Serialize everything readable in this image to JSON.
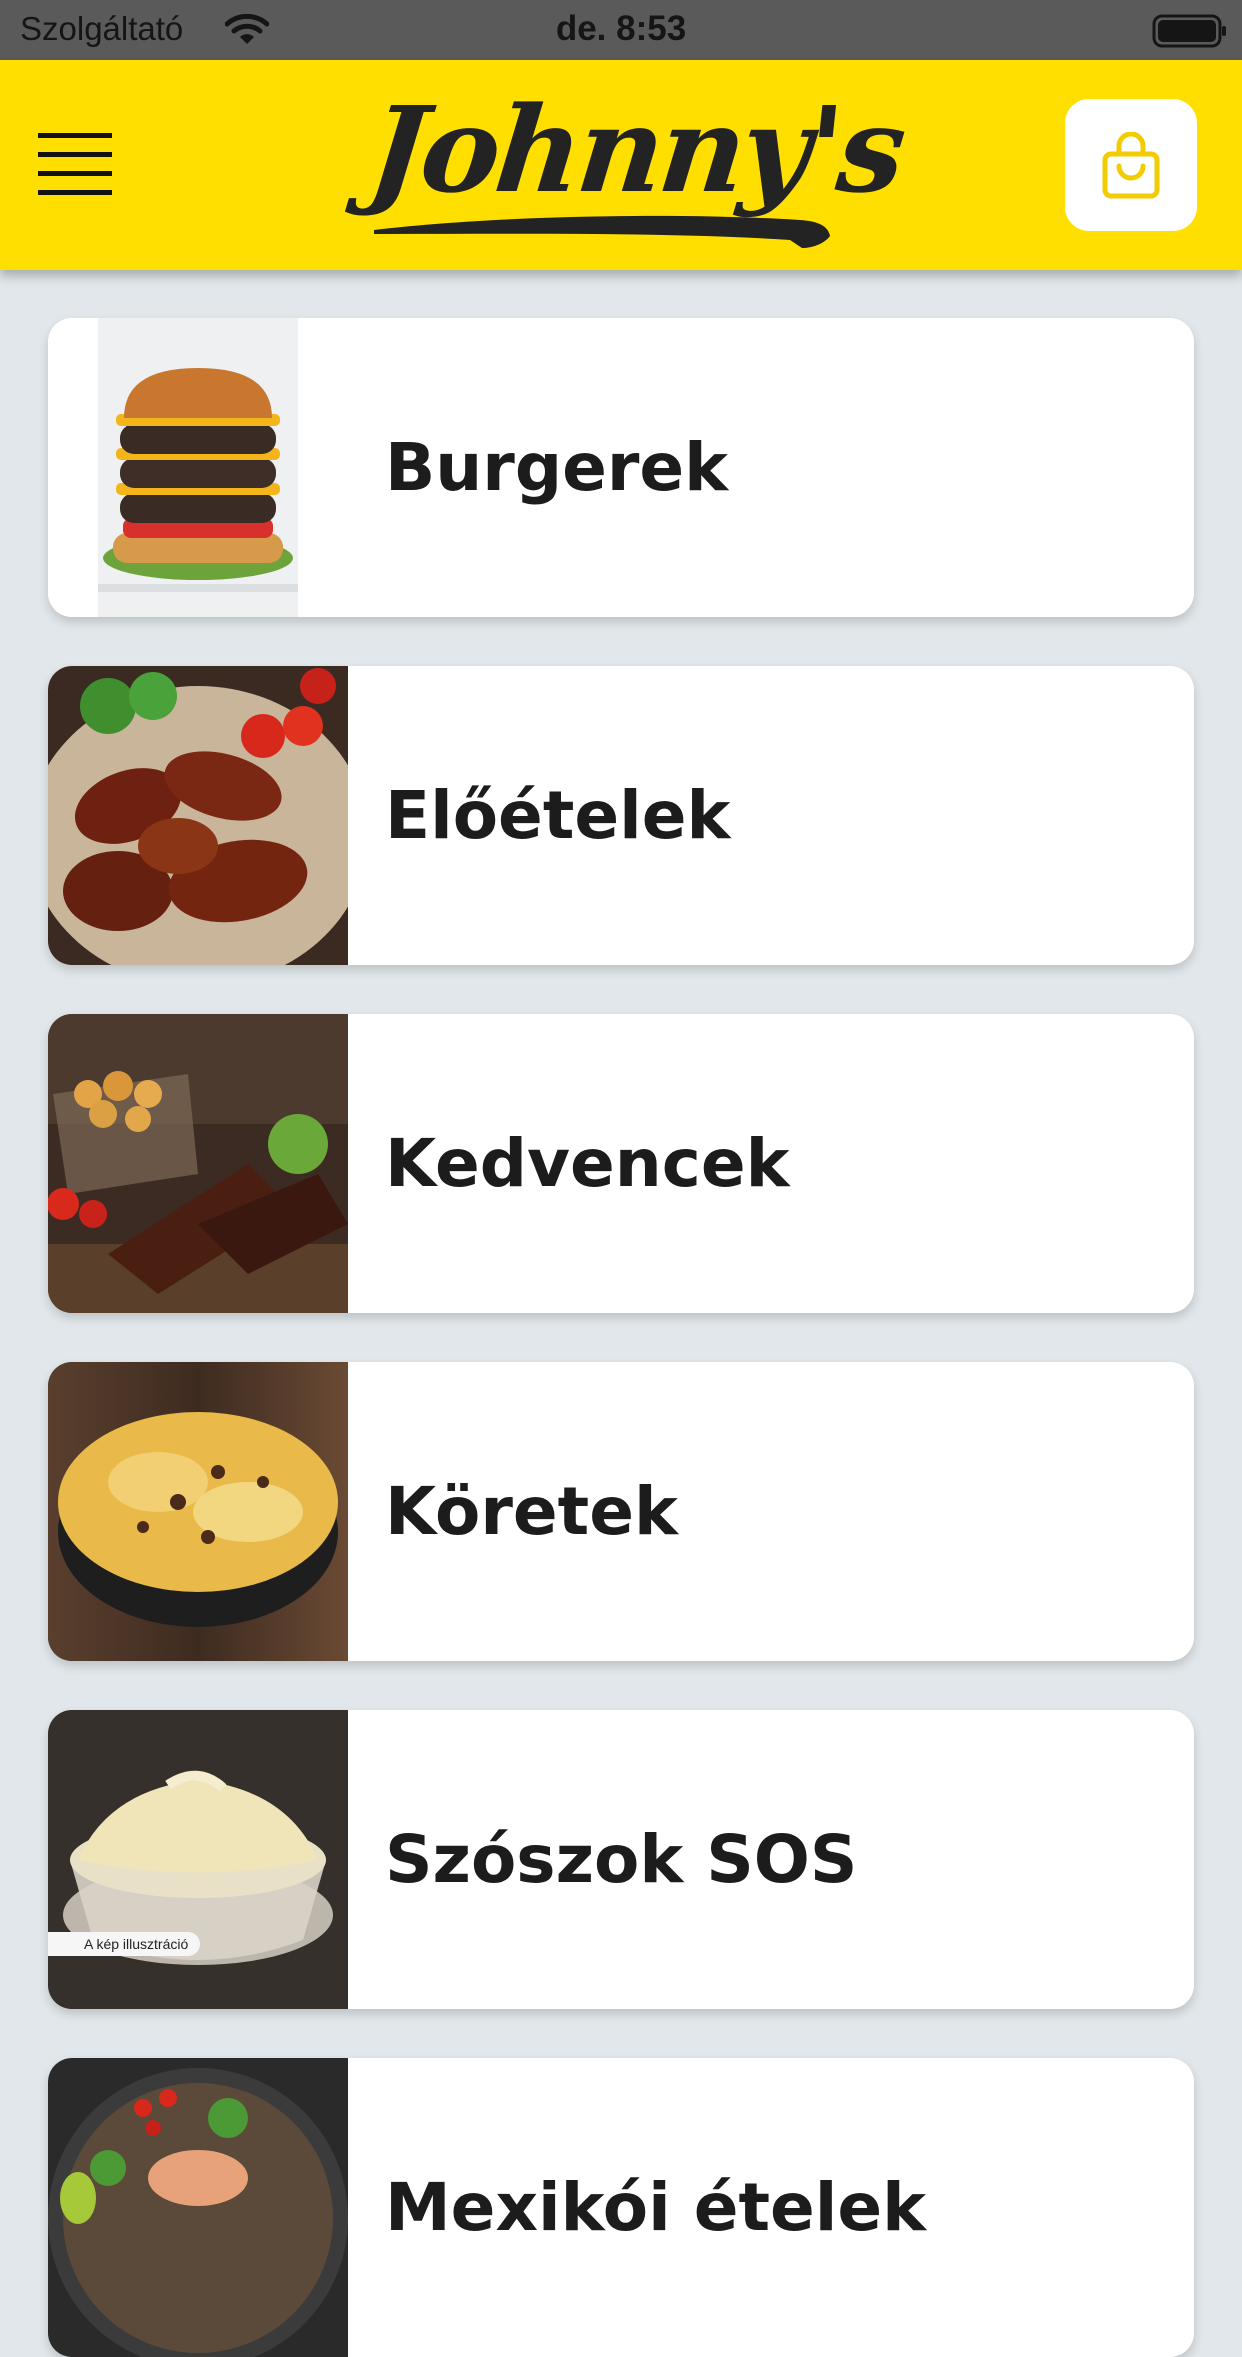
{
  "status_bar": {
    "carrier": "Szolgáltató",
    "time": "de. 8:53"
  },
  "header": {
    "logo_text": "Johnny's",
    "brand_color": "#ffdf00",
    "menu_icon": "hamburger-menu-icon",
    "cart_icon": "shopping-bag-icon"
  },
  "categories": [
    {
      "label": "Burgerek",
      "image": "stacked-cheeseburger"
    },
    {
      "label": "Előételek",
      "image": "bbq-chicken-wings"
    },
    {
      "label": "Kedvencek",
      "image": "ribs-and-fried-chicken"
    },
    {
      "label": "Köretek",
      "image": "loaded-cheese-fries"
    },
    {
      "label": "Szószok SOS",
      "image": "mayonnaise-bowl",
      "badge": "A kép illusztráció"
    },
    {
      "label": "Mexikói ételek",
      "image": "mexican-salad-plate"
    }
  ]
}
